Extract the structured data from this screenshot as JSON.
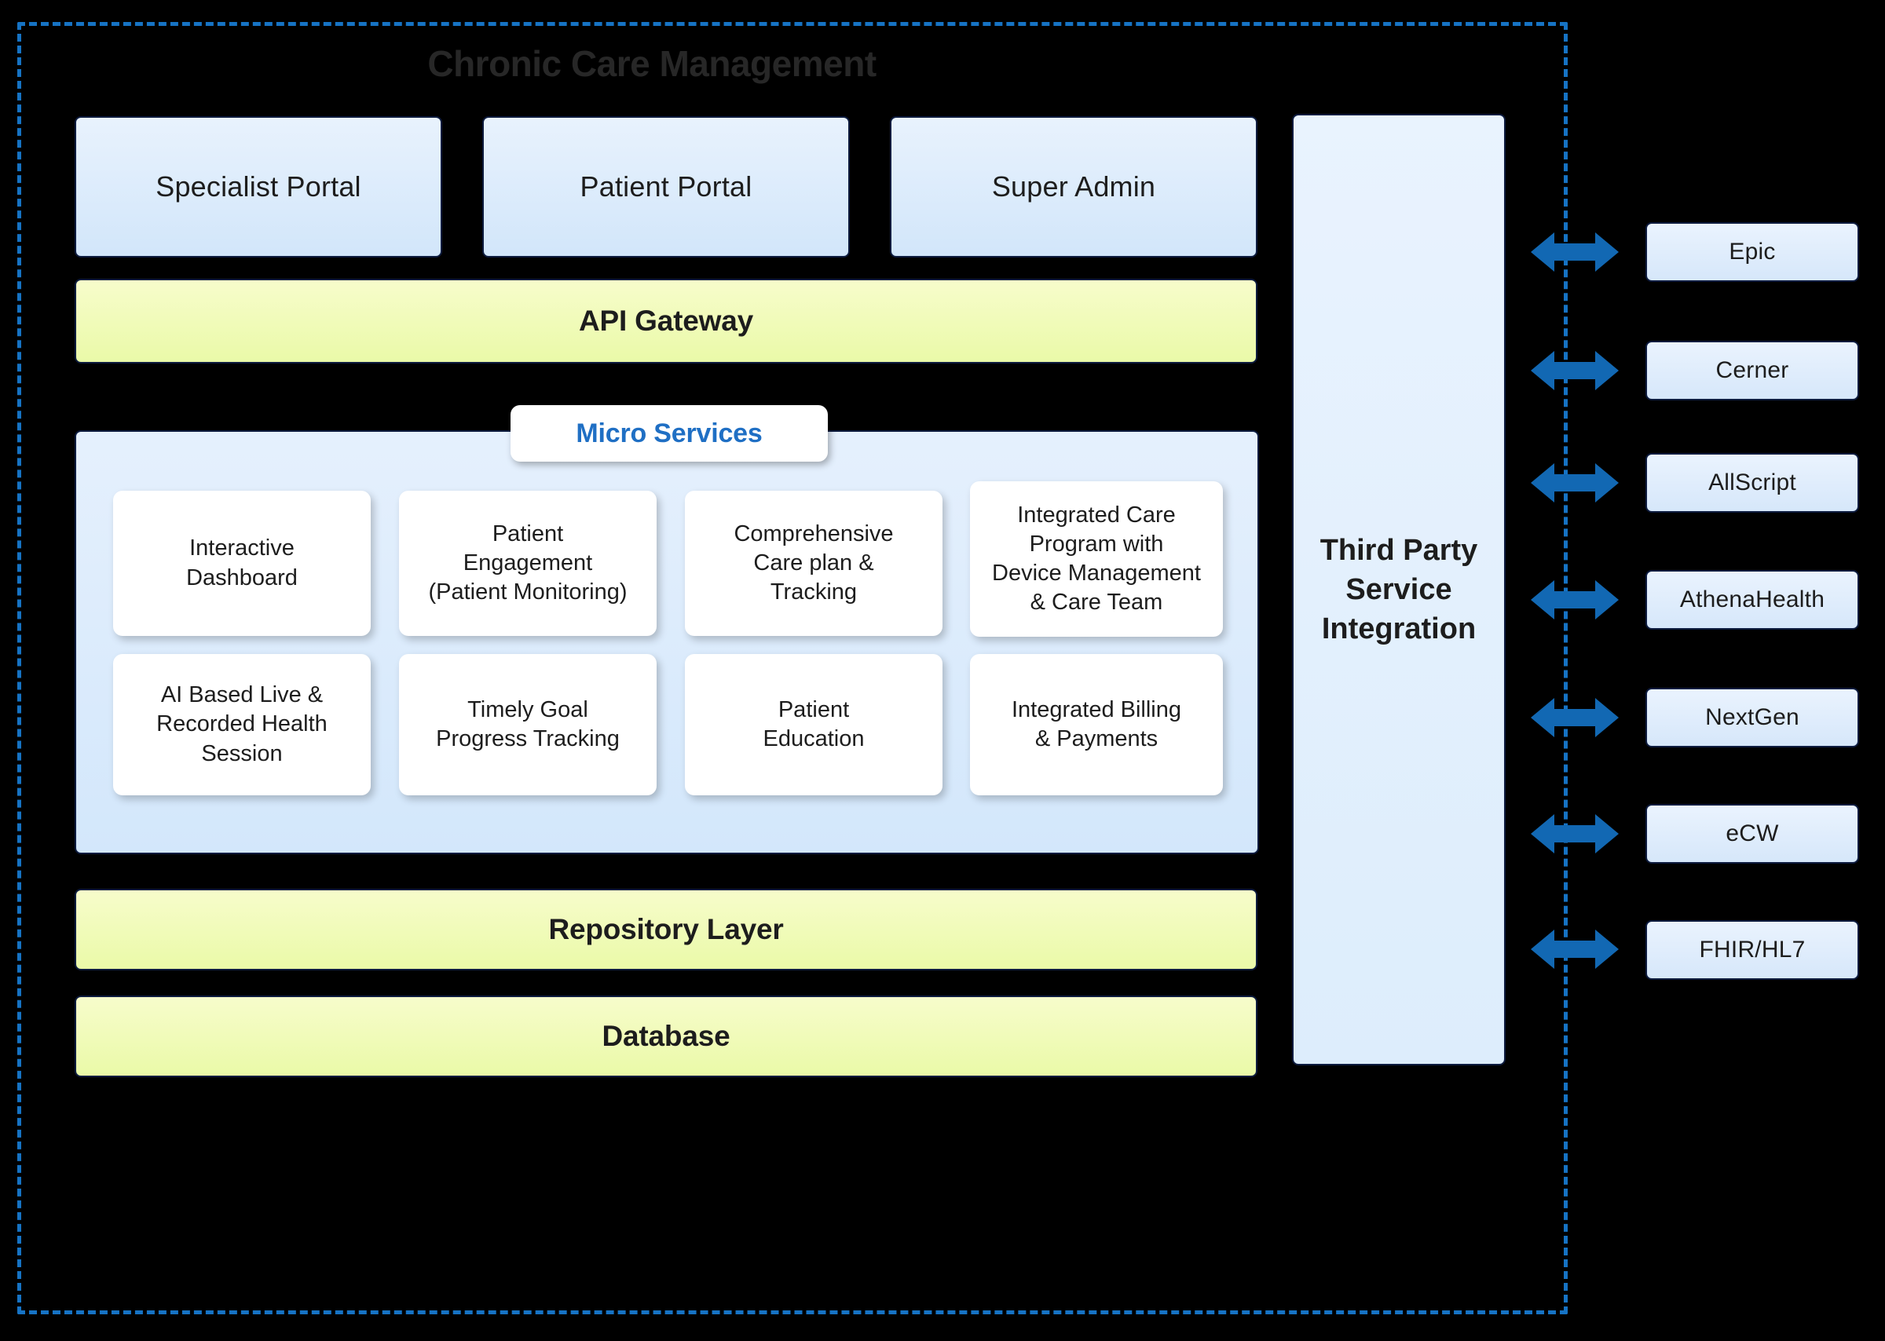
{
  "diagram": {
    "title": "Chronic Care Management",
    "boundary_color": "#1673c4",
    "arrow_color": "#1268b3",
    "accent_blue": "#1f6fc4"
  },
  "portals": [
    {
      "label": "Specialist Portal"
    },
    {
      "label": "Patient Portal"
    },
    {
      "label": "Super Admin"
    }
  ],
  "api_gateway": {
    "label": "API Gateway"
  },
  "micro_services": {
    "label": "Micro Services",
    "cards": [
      {
        "label": "Interactive\nDashboard"
      },
      {
        "label": "Patient\nEngagement\n(Patient Monitoring)"
      },
      {
        "label": "Comprehensive\nCare plan &\nTracking"
      },
      {
        "label": "Integrated Care\nProgram with\nDevice Management\n& Care Team"
      },
      {
        "label": "AI Based Live &\nRecorded Health\nSession"
      },
      {
        "label": "Timely Goal\nProgress Tracking"
      },
      {
        "label": "Patient\nEducation"
      },
      {
        "label": "Integrated Billing\n& Payments"
      }
    ]
  },
  "repository_layer": {
    "label": "Repository Layer"
  },
  "database": {
    "label": "Database"
  },
  "third_party": {
    "label": "Third Party\nService\nIntegration"
  },
  "external_systems": [
    {
      "label": "Epic"
    },
    {
      "label": "Cerner"
    },
    {
      "label": "AllScript"
    },
    {
      "label": "AthenaHealth"
    },
    {
      "label": "NextGen"
    },
    {
      "label": "eCW"
    },
    {
      "label": "FHIR/HL7"
    }
  ]
}
